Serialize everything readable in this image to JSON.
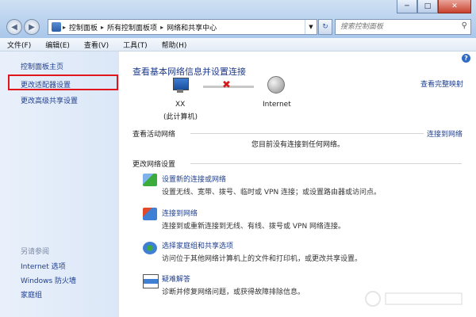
{
  "titlebar": {
    "minimize_glyph": "─",
    "maximize_glyph": "□",
    "close_glyph": "✕"
  },
  "address": {
    "crumbs": [
      "控制面板",
      "所有控制面板项",
      "网络和共享中心"
    ]
  },
  "search": {
    "placeholder": "搜索控制面板"
  },
  "menu": {
    "items": [
      "文件(F)",
      "编辑(E)",
      "查看(V)",
      "工具(T)",
      "帮助(H)"
    ]
  },
  "left": {
    "items": [
      "控制面板主页",
      "更改适配器设置",
      "更改高级共享设置"
    ],
    "see_also_title": "另请参阅",
    "see_also": [
      "Internet 选项",
      "Windows 防火墙",
      "家庭组"
    ]
  },
  "main": {
    "heading": "查看基本网络信息并设置连接",
    "full_map": "查看完整映射",
    "pc_name": "XX",
    "pc_sub": "(此计算机)",
    "internet": "Internet",
    "active_title": "查看活动网络",
    "connect_link": "连接到网络",
    "no_connection": "您目前没有连接到任何网络。",
    "change_title": "更改网络设置",
    "tasks": [
      {
        "title": "设置新的连接或网络",
        "desc": "设置无线、宽带、拨号、临时或 VPN 连接；或设置路由器或访问点。",
        "icon": "network-setup-icon"
      },
      {
        "title": "连接到网络",
        "desc": "连接到或重新连接到无线、有线、拨号或 VPN 网络连接。",
        "icon": "connect-network-icon"
      },
      {
        "title": "选择家庭组和共享选项",
        "desc": "访问位于其他网络计算机上的文件和打印机，或更改共享设置。",
        "icon": "homegroup-icon"
      },
      {
        "title": "疑难解答",
        "desc": "诊断并修复网络问题，或获得故障排除信息。",
        "icon": "troubleshoot-icon"
      }
    ]
  },
  "colors": {
    "link": "#1f3f8f",
    "highlight": "#e0161c",
    "heading": "#1e3a8a"
  }
}
